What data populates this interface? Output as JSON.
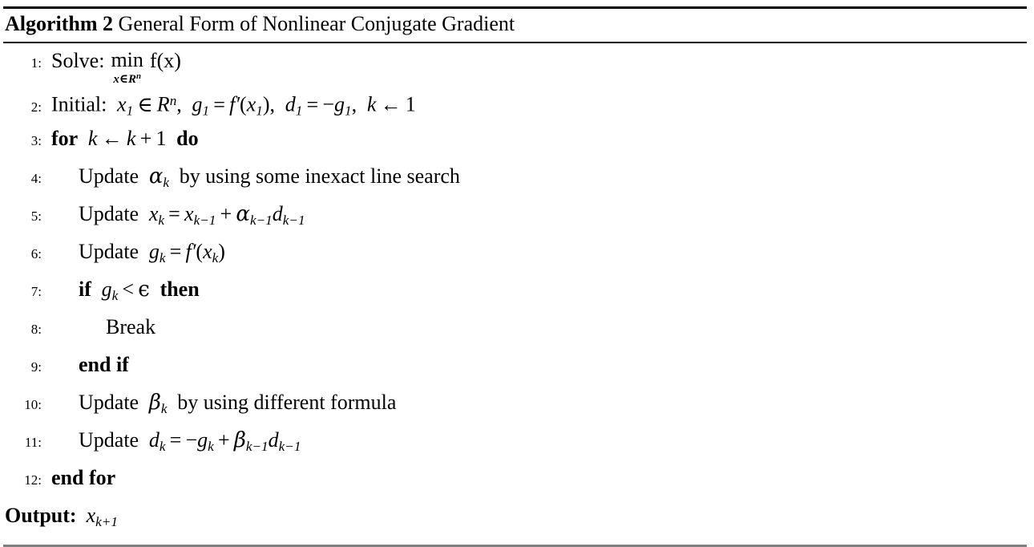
{
  "algorithm": {
    "label": "Algorithm 2",
    "title": "General Form of Nonlinear Conjugate Gradient",
    "line1": {
      "number": "1:",
      "label": "Solve:",
      "operator": "min",
      "operator_subscript_var": "x",
      "operator_subscript_in": "∈",
      "operator_subscript_set": "R",
      "operator_subscript_exp": "n",
      "objective": "f(x)"
    },
    "line2": {
      "number": "2:",
      "label": "Initial:",
      "x_var": "x",
      "x_sub": "1",
      "in": "∈",
      "set": "R",
      "set_exp": "n",
      "comma1": ",",
      "g_var": "g",
      "g_sub": "1",
      "eq1": "=",
      "fprime": "f′",
      "fprime_arg_var": "x",
      "fprime_arg_sub": "1",
      "comma2": ",",
      "d_var": "d",
      "d_sub": "1",
      "eq2": "=",
      "minus": "−",
      "neg_g_var": "g",
      "neg_g_sub": "1",
      "comma3": ",",
      "k_var": "k",
      "assign": "←",
      "k_value": "1"
    },
    "line3": {
      "number": "3:",
      "kw_for": "for",
      "k_var": "k",
      "assign": "←",
      "k_var2": "k",
      "plus": "+",
      "one": "1",
      "kw_do": "do"
    },
    "line4": {
      "number": "4:",
      "verb": "Update",
      "alpha": "α",
      "alpha_sub": "k",
      "text": "by using some inexact line search"
    },
    "line5": {
      "number": "5:",
      "verb": "Update",
      "x_var": "x",
      "x_sub": "k",
      "eq": "=",
      "x_var2": "x",
      "x_sub2": "k−1",
      "plus": "+",
      "alpha": "α",
      "alpha_sub": "k−1",
      "d_var": "d",
      "d_sub": "k−1"
    },
    "line6": {
      "number": "6:",
      "verb": "Update",
      "g_var": "g",
      "g_sub": "k",
      "eq": "=",
      "fprime": "f′",
      "paren_open": "(",
      "arg_var": "x",
      "arg_sub": "k",
      "paren_close": ")"
    },
    "line7": {
      "number": "7:",
      "kw_if": "if",
      "g_var": "g",
      "g_sub": "k",
      "lt": "<",
      "epsilon": "ϵ",
      "kw_then": "then"
    },
    "line8": {
      "number": "8:",
      "text": "Break"
    },
    "line9": {
      "number": "9:",
      "kw_end_if": "end if"
    },
    "line10": {
      "number": "10:",
      "verb": "Update",
      "beta": "β",
      "beta_sub": "k",
      "text": "by using different formula"
    },
    "line11": {
      "number": "11:",
      "verb": "Update",
      "d_var": "d",
      "d_sub": "k",
      "eq": "=",
      "minus": "−",
      "g_var": "g",
      "g_sub": "k",
      "plus": "+",
      "beta": "β",
      "beta_sub": "k−1",
      "d_var2": "d",
      "d_sub2": "k−1"
    },
    "line12": {
      "number": "12:",
      "kw_end_for": "end for"
    },
    "output": {
      "label": "Output:",
      "value_var": "x",
      "value_sub": "k+1"
    }
  },
  "colors": {
    "text": "#000000",
    "rule_top": "#000000",
    "rule_bottom": "#808080",
    "background": "#ffffff"
  }
}
